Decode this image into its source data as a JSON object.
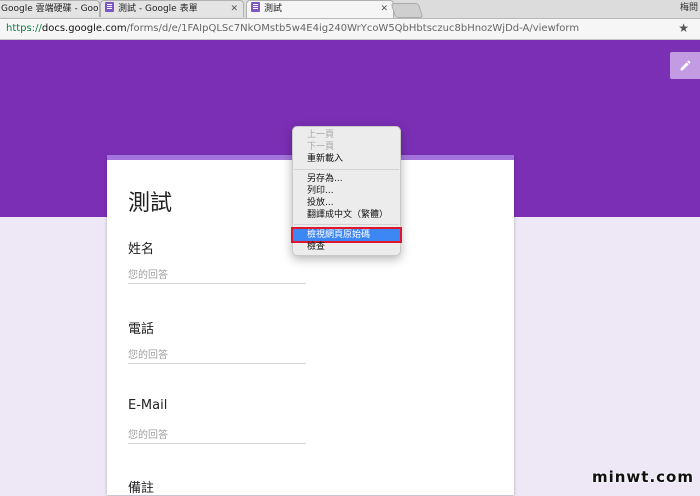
{
  "browser": {
    "tabs": [
      {
        "label": "Google 雲端硬碟 - Google 雲端硬..."
      },
      {
        "label": "測試 - Google 表單"
      },
      {
        "label": "測試"
      }
    ],
    "user_label": "梅問",
    "url_secure": "https://",
    "url_host": "docs.google.com",
    "url_path": "/forms/d/e/1FAIpQLSc7NkOMstb5w4E4ig240WrYcoW5QbHbtsczuc8bHnozWjDd-A/viewform",
    "star_icon": "★"
  },
  "form": {
    "title": "測試",
    "answer_placeholder": "您的回答",
    "questions": [
      {
        "label": "姓名"
      },
      {
        "label": "電話"
      },
      {
        "label": "E-Mail"
      },
      {
        "label": "備註"
      }
    ]
  },
  "context_menu": {
    "items": [
      {
        "label": "上一頁",
        "disabled": true
      },
      {
        "label": "下一頁",
        "disabled": true
      },
      {
        "label": "重新載入"
      },
      {
        "label": "另存為..."
      },
      {
        "label": "列印..."
      },
      {
        "label": "投放..."
      },
      {
        "label": "翻譯成中文（繁體）"
      },
      {
        "label": "檢視網頁原始碼",
        "highlighted": true
      },
      {
        "label": "檢查"
      }
    ]
  },
  "watermark": "minwt.com",
  "colors": {
    "banner": "#7b2fb5",
    "background": "#ede7f6",
    "card_accent": "#a374dd",
    "menu_highlight": "#3d87f5",
    "highlight_outline": "#e0142a"
  }
}
